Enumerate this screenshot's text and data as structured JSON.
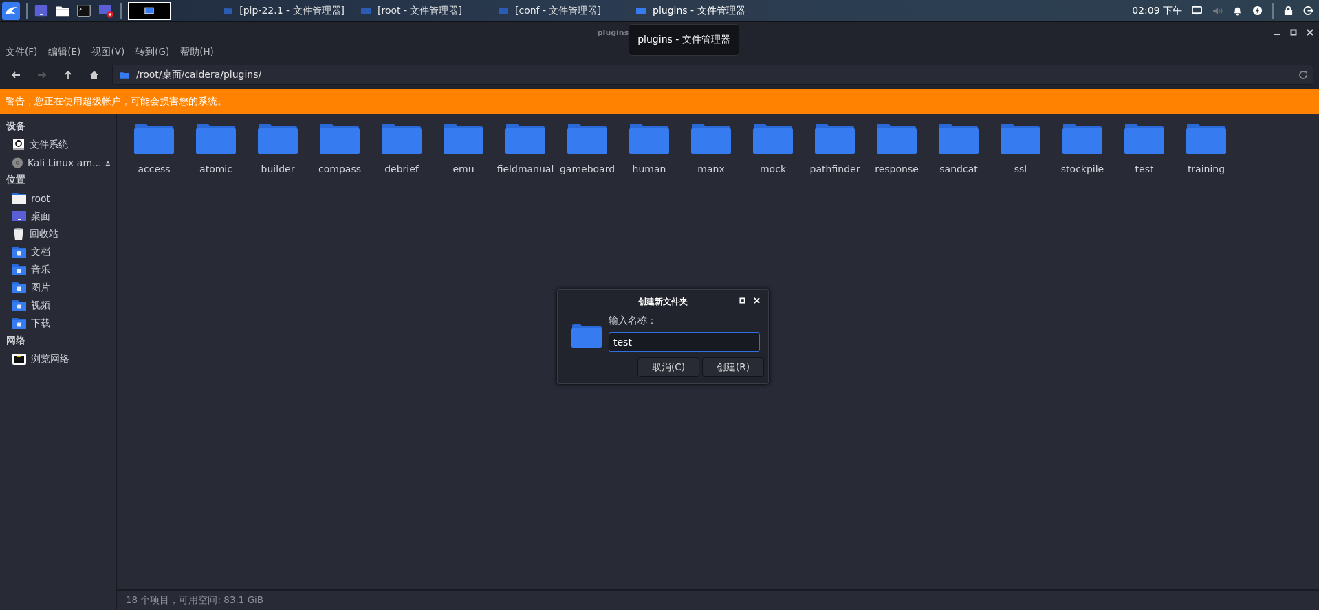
{
  "taskbar": {
    "tasks": [
      {
        "label": "[pip-22.1 - 文件管理器]",
        "selected": false
      },
      {
        "label": "[root - 文件管理器]",
        "selected": false
      },
      {
        "label": "[conf - 文件管理器]",
        "selected": false
      },
      {
        "label": "plugins - 文件管理器",
        "selected": true
      }
    ],
    "clock": "02:09 下午"
  },
  "window": {
    "title": "plugins",
    "tooltip": "plugins - 文件管理器"
  },
  "menu": [
    "文件(F)",
    "编辑(E)",
    "视图(V)",
    "转到(G)",
    "帮助(H)"
  ],
  "toolbar": {
    "back_disabled": false,
    "forward_disabled": true,
    "path": "/root/桌面/caldera/plugins/"
  },
  "warning": "警告，您正在使用超级帐户，可能会损害您的系统。",
  "sidebar": [
    {
      "heading": "设备",
      "items": [
        {
          "kind": "drive",
          "label": "文件系统"
        },
        {
          "kind": "disc",
          "label": "Kali Linux am..."
        }
      ]
    },
    {
      "heading": "位置",
      "items": [
        {
          "kind": "home",
          "label": "root"
        },
        {
          "kind": "desktop",
          "label": "桌面"
        },
        {
          "kind": "trash",
          "label": "回收站"
        },
        {
          "kind": "documents",
          "label": "文档"
        },
        {
          "kind": "music",
          "label": "音乐"
        },
        {
          "kind": "pictures",
          "label": "图片"
        },
        {
          "kind": "videos",
          "label": "视频"
        },
        {
          "kind": "downloads",
          "label": "下载"
        }
      ]
    },
    {
      "heading": "网络",
      "items": [
        {
          "kind": "network",
          "label": "浏览网络"
        }
      ]
    }
  ],
  "folders": [
    "access",
    "atomic",
    "builder",
    "compass",
    "debrief",
    "emu",
    "fieldmanual",
    "gameboard",
    "human",
    "manx",
    "mock",
    "pathfinder",
    "response",
    "sandcat",
    "ssl",
    "stockpile",
    "test",
    "training"
  ],
  "status": "18 个项目，可用空间: 83.1 GiB",
  "dialog": {
    "title": "创建新文件夹",
    "label": "输入名称：",
    "value": "test",
    "buttons": [
      "取消(C)",
      "创建(R)"
    ]
  }
}
